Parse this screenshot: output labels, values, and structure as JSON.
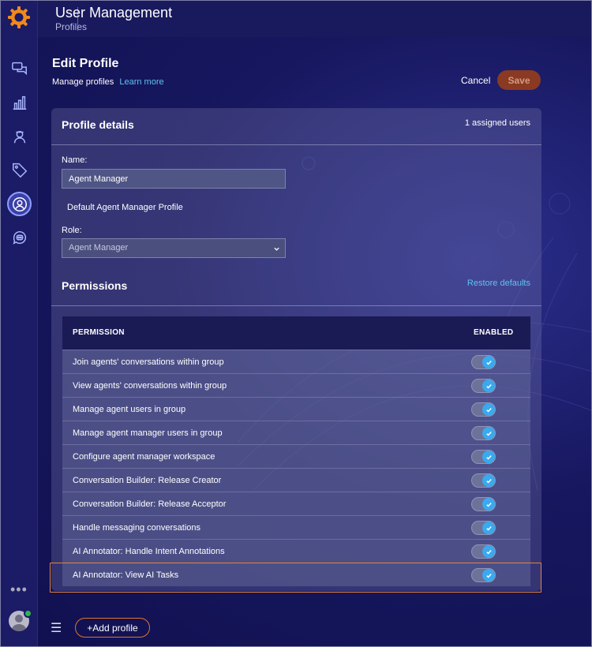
{
  "app": {
    "title": "User Management",
    "subtitle": "Profiles"
  },
  "sidebar": {
    "items": [
      {
        "icon": "conversations-icon"
      },
      {
        "icon": "analytics-icon"
      },
      {
        "icon": "agent-icon"
      },
      {
        "icon": "tag-icon"
      },
      {
        "icon": "user-management-icon",
        "active": true
      },
      {
        "icon": "bot-icon"
      }
    ],
    "more": "•••"
  },
  "header": {
    "title": "Edit Profile",
    "subtitle": "Manage profiles",
    "learn_more": "Learn more",
    "cancel_label": "Cancel",
    "save_label": "Save"
  },
  "profile": {
    "section_title": "Profile details",
    "assigned_users": "1 assigned users",
    "name_label": "Name:",
    "name_value": "Agent Manager",
    "description": "Default Agent Manager Profile",
    "role_label": "Role:",
    "role_value": "Agent Manager"
  },
  "permissions": {
    "section_title": "Permissions",
    "restore_label": "Restore defaults",
    "col_permission": "PERMISSION",
    "col_enabled": "ENABLED",
    "rows": [
      {
        "label": "Join agents' conversations within group",
        "enabled": true
      },
      {
        "label": "View agents' conversations within group",
        "enabled": true
      },
      {
        "label": "Manage agent users in group",
        "enabled": true
      },
      {
        "label": "Manage agent manager users in group",
        "enabled": true
      },
      {
        "label": "Configure agent manager workspace",
        "enabled": true
      },
      {
        "label": "Conversation Builder: Release Creator",
        "enabled": true
      },
      {
        "label": "Conversation Builder: Release Acceptor",
        "enabled": true
      },
      {
        "label": "Handle messaging conversations",
        "enabled": true
      },
      {
        "label": "AI Annotator: Handle Intent Annotations",
        "enabled": true
      },
      {
        "label": "AI Annotator: View AI Tasks",
        "enabled": true
      }
    ]
  },
  "footer": {
    "add_profile_label": "+Add profile"
  },
  "colors": {
    "accent": "#e0742e",
    "link": "#5ec3f0",
    "toggle_on": "#3aa9ee"
  }
}
